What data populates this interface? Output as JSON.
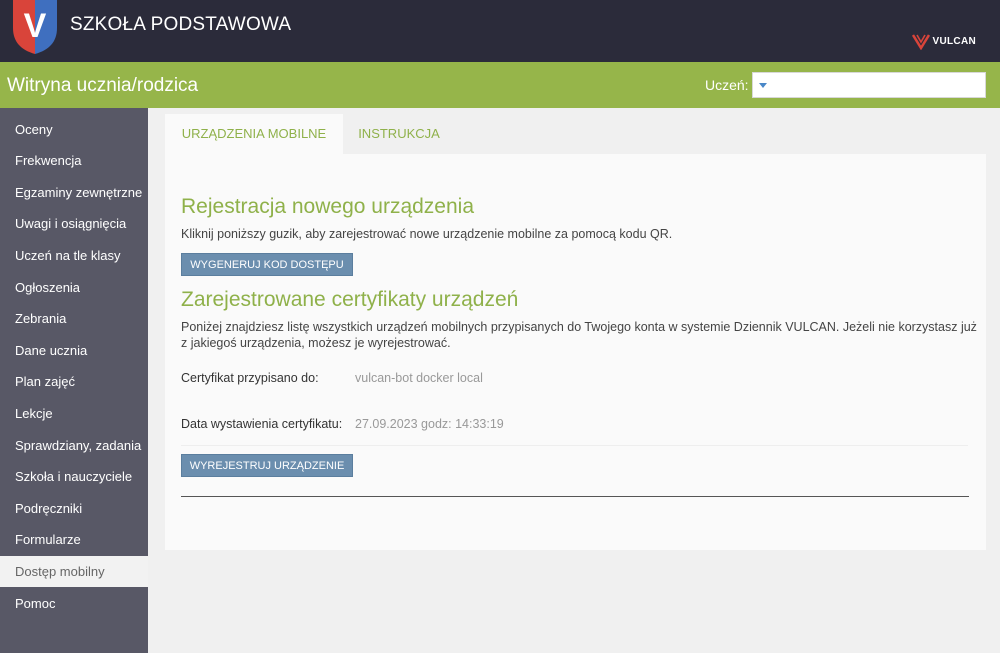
{
  "header": {
    "school_name": "SZKOŁA PODSTAWOWA",
    "logo_letter": "V",
    "vulcan_brand": "VULCAN",
    "colors": {
      "dark": "#2b2b3a",
      "shield_red": "#d9443a",
      "shield_blue": "#3f6fbf"
    }
  },
  "subheader": {
    "title": "Witryna ucznia/rodzica",
    "student_label": "Uczeń:",
    "student_value": "",
    "color": "#96b54a"
  },
  "sidebar": {
    "items": [
      {
        "label": "Oceny"
      },
      {
        "label": "Frekwencja"
      },
      {
        "label": "Egzaminy zewnętrzne"
      },
      {
        "label": "Uwagi i osiągnięcia"
      },
      {
        "label": "Uczeń na tle klasy"
      },
      {
        "label": "Ogłoszenia"
      },
      {
        "label": "Zebrania"
      },
      {
        "label": "Dane ucznia"
      },
      {
        "label": "Plan zajęć"
      },
      {
        "label": "Lekcje"
      },
      {
        "label": "Sprawdziany, zadania"
      },
      {
        "label": "Szkoła i nauczyciele"
      },
      {
        "label": "Podręczniki"
      },
      {
        "label": "Formularze"
      },
      {
        "label": "Dostęp mobilny",
        "active": true
      },
      {
        "label": "Pomoc"
      }
    ]
  },
  "tabs": [
    {
      "label": "URZĄDZENIA MOBILNE",
      "active": true
    },
    {
      "label": "INSTRUKCJA",
      "active": false
    }
  ],
  "main": {
    "register_heading": "Rejestracja nowego urządzenia",
    "register_text": "Kliknij poniższy guzik, aby zarejestrować nowe urządzenie mobilne za pomocą kodu QR.",
    "generate_button": "WYGENERUJ KOD DOSTĘPU",
    "certs_heading": "Zarejestrowane certyfikaty urządzeń",
    "certs_text_line1": "Poniżej znajdziesz listę wszystkich urządzeń mobilnych przypisanych do Twojego konta w systemie Dziennik VULCAN. Jeżeli nie korzystasz już",
    "certs_text_line2": "z jakiegoś urządzenia, możesz je wyrejestrować.",
    "cert_assigned_label": "Certyfikat przypisano do:",
    "cert_assigned_value": "vulcan-bot docker local",
    "cert_date_label": "Data wystawienia certyfikatu:",
    "cert_date_value": "27.09.2023 godz: 14:33:19",
    "unregister_button": "WYREJESTRUJ URZĄDZENIE"
  }
}
